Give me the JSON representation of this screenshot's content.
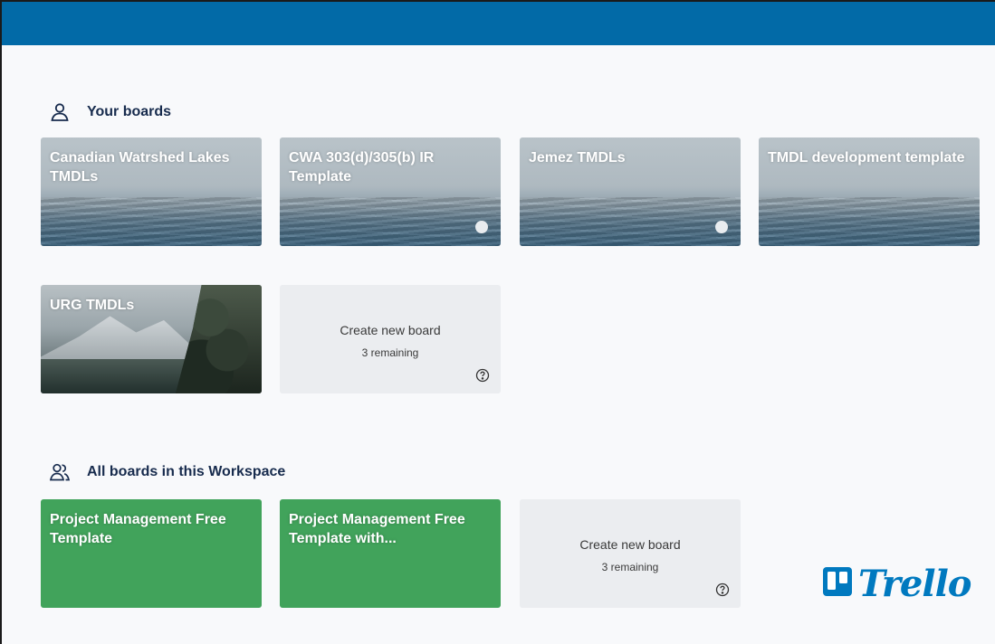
{
  "colors": {
    "topbar": "#026aa7",
    "green_tile": "#41a35b",
    "create_tile": "#ebedf0",
    "heading_text": "#172b4d",
    "trello_blue": "#0079bf"
  },
  "your_boards": {
    "heading": "Your boards",
    "icon": "person-icon",
    "boards": [
      {
        "title": "Canadian Watrshed Lakes TMDLs",
        "background": "sea"
      },
      {
        "title": "CWA 303(d)/305(b) IR Template",
        "background": "sea",
        "indicator": true
      },
      {
        "title": "Jemez TMDLs",
        "background": "sea",
        "indicator": true
      },
      {
        "title": "TMDL development template",
        "background": "sea"
      },
      {
        "title": "URG TMDLs",
        "background": "mountain-lake"
      }
    ],
    "create": {
      "label": "Create new board",
      "remaining": "3 remaining",
      "icon": "help-circle-icon"
    }
  },
  "workspace_boards": {
    "heading": "All boards in this Workspace",
    "icon": "people-icon",
    "boards": [
      {
        "title": "Project Management Free Template",
        "background": "green"
      },
      {
        "title": "Project Management Free Template with...",
        "background": "green"
      }
    ],
    "create": {
      "label": "Create new board",
      "remaining": "3 remaining",
      "icon": "help-circle-icon"
    }
  },
  "logo": {
    "text": "Trello",
    "icon": "trello-board-icon"
  }
}
